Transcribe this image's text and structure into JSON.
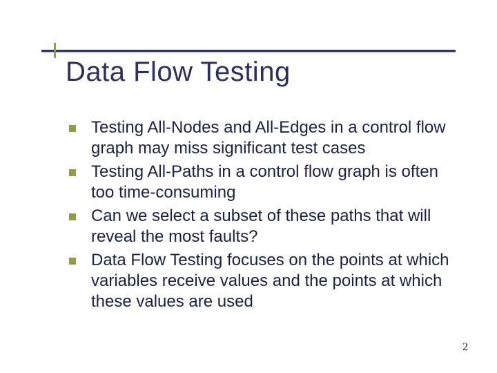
{
  "slide": {
    "title": "Data Flow Testing",
    "bullets": [
      "Testing All-Nodes and All-Edges in a control flow graph may miss significant test cases",
      "Testing All-Paths in a control flow graph is often too time-consuming",
      "Can we select a subset of these paths that will reveal the most faults?",
      "Data Flow Testing focuses on the points at which variables receive values and the points at which these values are used"
    ],
    "page_number": "2"
  }
}
